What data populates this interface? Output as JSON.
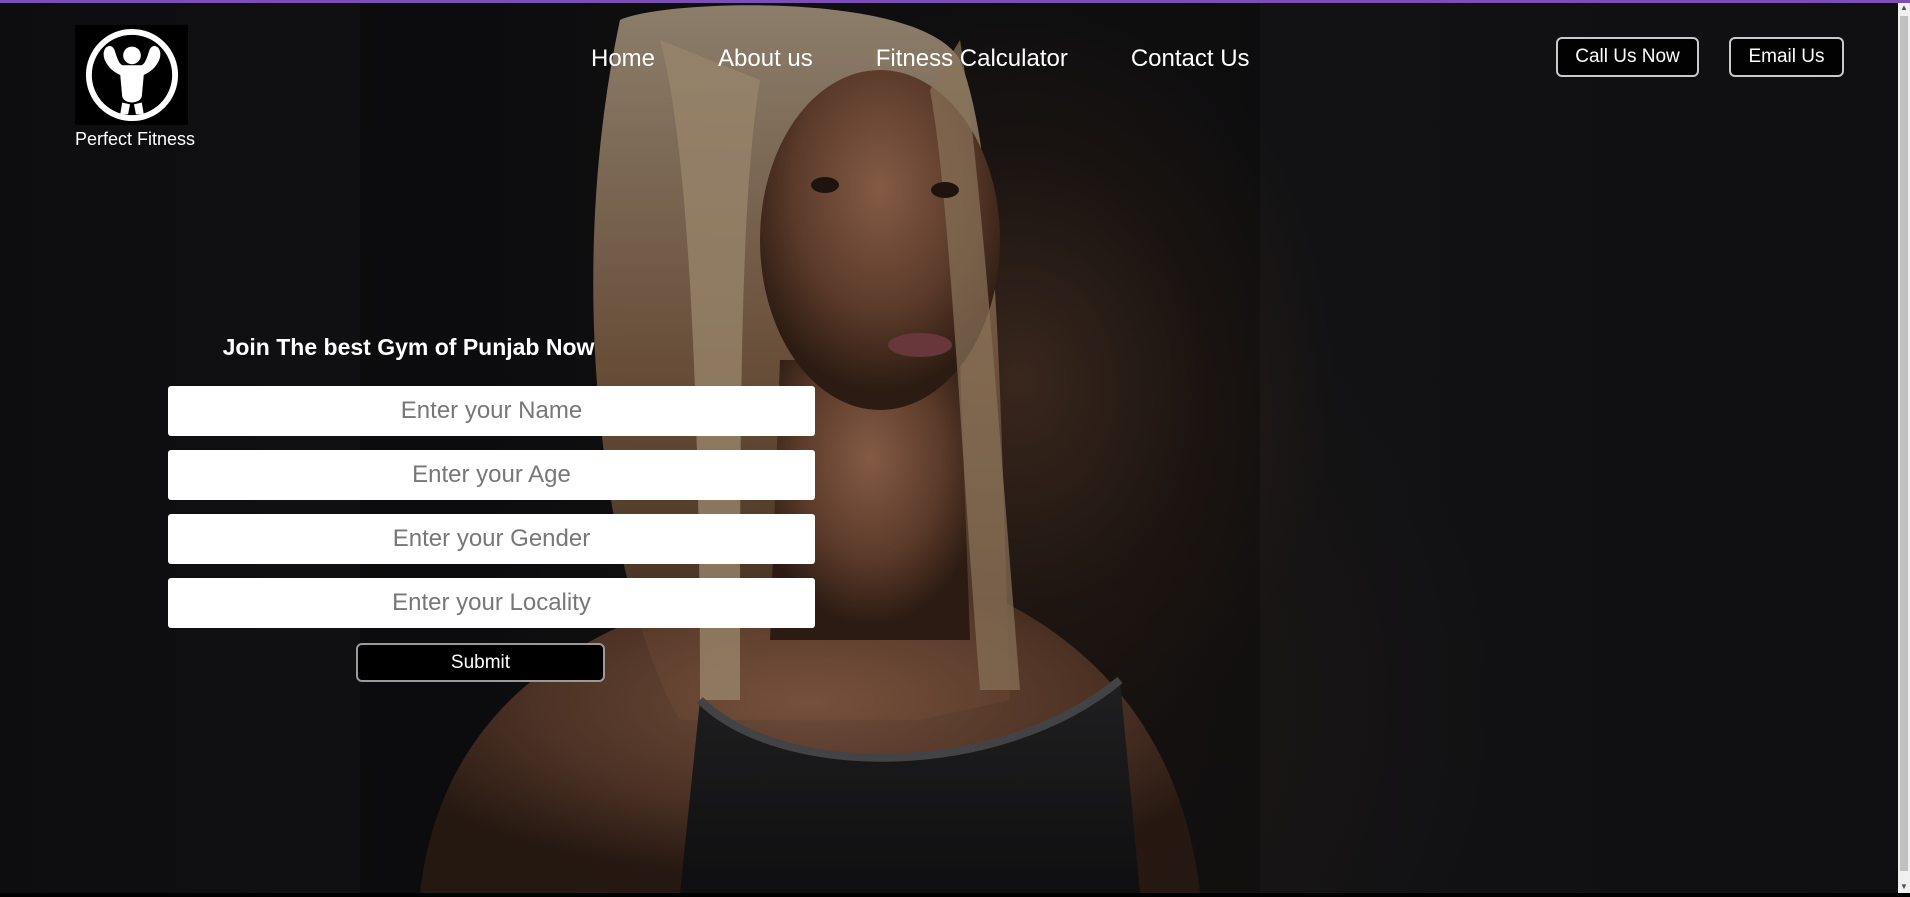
{
  "brand": {
    "name": "Perfect Fitness",
    "logo_icon": "flexing-bodybuilder-icon"
  },
  "nav": {
    "items": [
      {
        "label": "Home"
      },
      {
        "label": "About us"
      },
      {
        "label": "Fitness Calculator"
      },
      {
        "label": "Contact Us"
      }
    ]
  },
  "header_buttons": {
    "call_label": "Call Us Now",
    "email_label": "Email Us"
  },
  "form": {
    "title": "Join The best Gym of Punjab Now",
    "fields": {
      "name_placeholder": "Enter your Name",
      "age_placeholder": "Enter your Age",
      "gender_placeholder": "Enter your Gender",
      "locality_placeholder": "Enter your Locality"
    },
    "submit_label": "Submit"
  },
  "colors": {
    "accent_top": "#7b4fb5",
    "background": "#121214",
    "text": "#ffffff"
  }
}
